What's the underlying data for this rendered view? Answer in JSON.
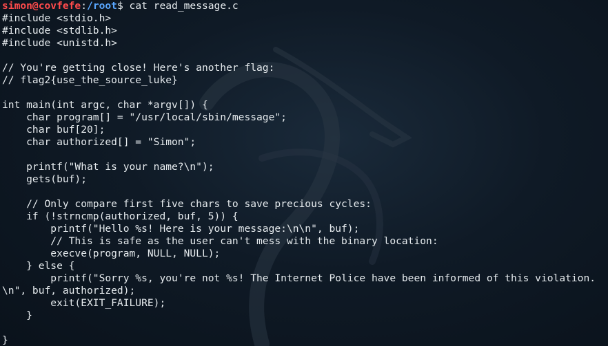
{
  "prompt": {
    "user_host": "simon@covfefe",
    "separator": ":",
    "path": "/root",
    "symbol": "$",
    "command": " cat read_message.c"
  },
  "lines": [
    "#include <stdio.h>",
    "#include <stdlib.h>",
    "#include <unistd.h>",
    "",
    "// You're getting close! Here's another flag:",
    "// flag2{use_the_source_luke}",
    "",
    "int main(int argc, char *argv[]) {",
    "    char program[] = \"/usr/local/sbin/message\";",
    "    char buf[20];",
    "    char authorized[] = \"Simon\";",
    "",
    "    printf(\"What is your name?\\n\");",
    "    gets(buf);",
    "",
    "    // Only compare first five chars to save precious cycles:",
    "    if (!strncmp(authorized, buf, 5)) {",
    "        printf(\"Hello %s! Here is your message:\\n\\n\", buf);",
    "        // This is safe as the user can't mess with the binary location:",
    "        execve(program, NULL, NULL);",
    "    } else {",
    "        printf(\"Sorry %s, you're not %s! The Internet Police have been informed of this violation.",
    "\\n\", buf, authorized);",
    "        exit(EXIT_FAILURE);",
    "    }",
    "",
    "}"
  ],
  "background_icon": "kali-dragon-icon",
  "colors": {
    "background": "#0f1a26",
    "text": "#e6ebee",
    "user_host": "#ff4b4b",
    "path": "#59a7ff"
  }
}
